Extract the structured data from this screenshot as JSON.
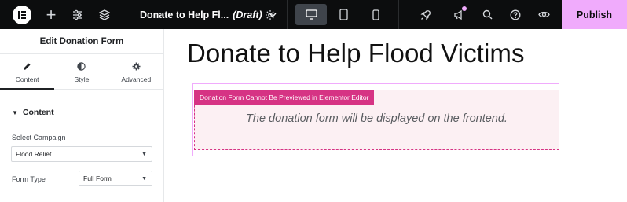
{
  "topbar": {
    "doc_title": "Donate to Help Fl...",
    "doc_status": "(Draft)",
    "publish_label": "Publish",
    "plus_glyph": "+",
    "accent_color": "#f0abfc"
  },
  "panel": {
    "title": "Edit Donation Form",
    "tabs": [
      {
        "label": "Content",
        "icon": "pencil-icon",
        "active": true
      },
      {
        "label": "Style",
        "icon": "half-circle-icon",
        "active": false
      },
      {
        "label": "Advanced",
        "icon": "gear-icon",
        "active": false
      }
    ],
    "section_title": "Content",
    "fields": {
      "campaign_label": "Select Campaign",
      "campaign_value": "Flood Relief",
      "form_type_label": "Form Type",
      "form_type_value": "Full Form"
    }
  },
  "canvas": {
    "heading": "Donate to Help Flood Victims",
    "widget_tag": "Donation Form Cannot Be Previewed in Elementor Editor",
    "widget_message": "The donation form will be displayed on the frontend.",
    "tag_color": "#d63384"
  }
}
